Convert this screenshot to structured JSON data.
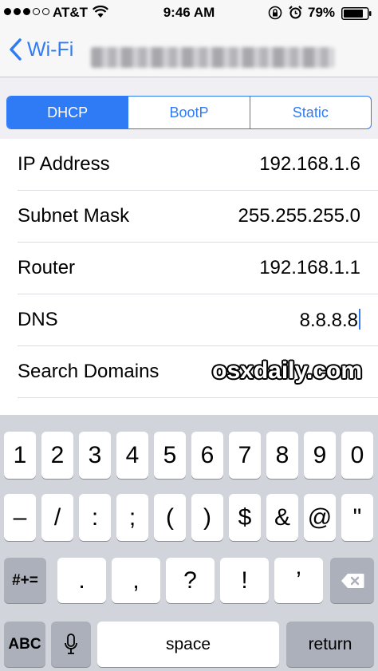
{
  "status_bar": {
    "carrier": "AT&T",
    "time": "9:46 AM",
    "battery": "79%",
    "signal_filled": 3,
    "signal_total": 5
  },
  "nav": {
    "back_label": "Wi-Fi",
    "accent_color": "#2f7bf5"
  },
  "segments": [
    {
      "label": "DHCP",
      "active": true
    },
    {
      "label": "BootP",
      "active": false
    },
    {
      "label": "Static",
      "active": false
    }
  ],
  "rows": [
    {
      "label": "IP Address",
      "value": "192.168.1.6"
    },
    {
      "label": "Subnet Mask",
      "value": "255.255.255.0"
    },
    {
      "label": "Router",
      "value": "192.168.1.1"
    },
    {
      "label": "DNS",
      "value": "8.8.8.8"
    },
    {
      "label": "Search Domains",
      "value": ""
    }
  ],
  "watermark": "osxdaily.com",
  "keyboard": {
    "row1": [
      "1",
      "2",
      "3",
      "4",
      "5",
      "6",
      "7",
      "8",
      "9",
      "0"
    ],
    "row2": [
      "–",
      "/",
      ":",
      ";",
      "(",
      ")",
      "$",
      "&",
      "@",
      "\""
    ],
    "row3_mode": "#+=",
    "row3": [
      ".",
      ",",
      "?",
      "!",
      "’"
    ],
    "abc": "ABC",
    "space": "space",
    "return": "return"
  }
}
